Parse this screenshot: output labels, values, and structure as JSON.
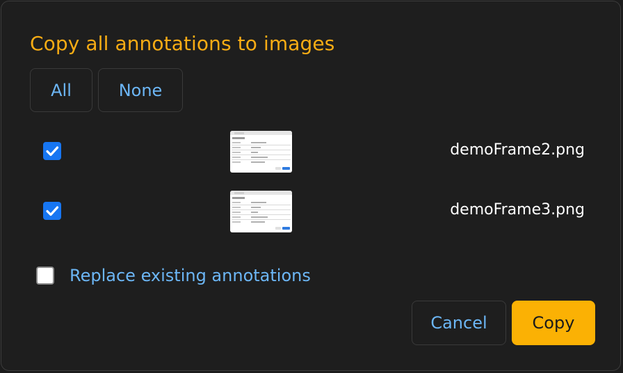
{
  "dialog": {
    "title": "Copy all annotations to images",
    "select_all_label": "All",
    "select_none_label": "None",
    "images": [
      {
        "filename": "demoFrame2.png",
        "checked": true
      },
      {
        "filename": "demoFrame3.png",
        "checked": true
      }
    ],
    "replace_label": "Replace existing annotations",
    "replace_checked": false,
    "cancel_label": "Cancel",
    "copy_label": "Copy"
  },
  "colors": {
    "title": "#f9ac14",
    "link": "#6cb6f5",
    "checkbox": "#1776f2",
    "primary_button": "#fbb104"
  }
}
